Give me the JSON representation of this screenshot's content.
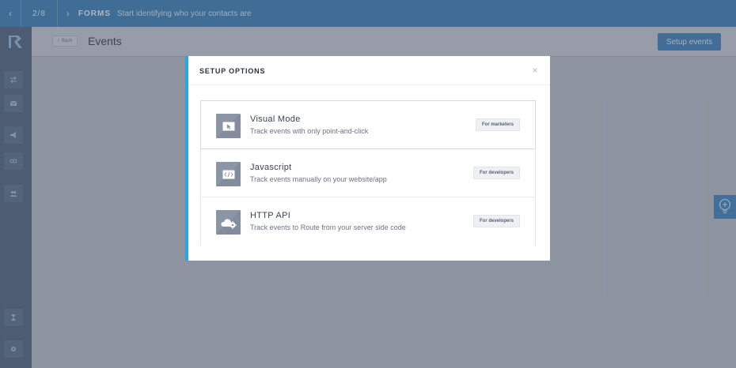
{
  "topbar": {
    "step": "2/8",
    "section": "FORMS",
    "description": "Start identifying who your contacts are"
  },
  "header": {
    "back_label": "Back",
    "title": "Events",
    "setup_button": "Setup events"
  },
  "modal": {
    "title": "SETUP OPTIONS",
    "close_glyph": "×",
    "options": [
      {
        "title": "Visual Mode",
        "description": "Track events with only point-and-click",
        "badge": "For marketers",
        "icon": "visual-cursor-icon"
      },
      {
        "title": "Javascript",
        "description": "Track events manually on your website/app",
        "badge": "For developers",
        "icon": "code-icon"
      },
      {
        "title": "HTTP API",
        "description": "Track events to Route from your server side code",
        "badge": "For developers",
        "icon": "cloud-gear-icon"
      }
    ]
  },
  "colors": {
    "accent": "#2aa6de",
    "topbar": "#3d7fb4",
    "sidebar": "#52657d",
    "primary_button": "#3f7fb5"
  }
}
